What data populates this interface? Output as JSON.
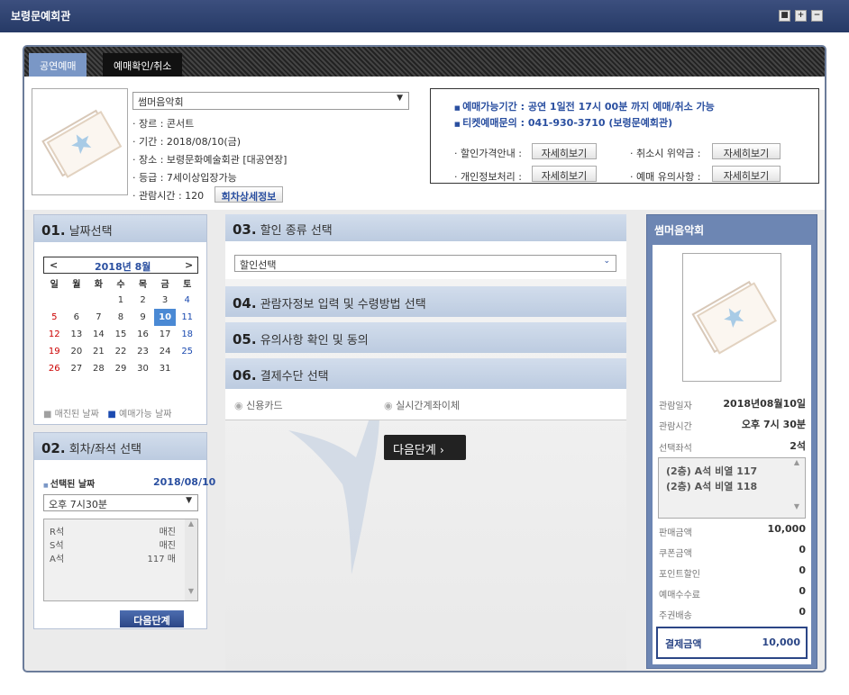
{
  "window": {
    "title": "보령문예회관",
    "btn_min": "■",
    "btn_plus": "+",
    "btn_close": "−"
  },
  "tabs": [
    {
      "label": "공연예매"
    },
    {
      "label": "예매확인/취소"
    }
  ],
  "show": {
    "title": "썸머음악회",
    "genre": "· 장르 : 콘서트",
    "period": "· 기간 : 2018/08/10(금)",
    "venue": "· 장소 : 보령문화예술회관 [대공연장]",
    "grade": "· 등급 : 7세이상입장가능",
    "runtime": "· 관람시간 : 120",
    "detail_btn": "회차상세정보"
  },
  "notice": {
    "line1": "예매가능기간 : 공연 1일전 17시 00분 까지 예매/취소 가능",
    "line2": "티켓예매문의 : 041-930-3710 (보령문예회관)",
    "items": [
      {
        "label": "· 할인가격안내 :",
        "btn": "자세히보기"
      },
      {
        "label": "· 취소시 위약금 :",
        "btn": "자세히보기"
      },
      {
        "label": "· 개인정보처리 :",
        "btn": "자세히보기"
      },
      {
        "label": "· 예매 유의사항 :",
        "btn": "자세히보기"
      }
    ]
  },
  "step01": {
    "num": "01.",
    "title": "날짜선택",
    "month": "2018년 8월",
    "prev": "<",
    "next": ">",
    "weekdays": [
      "일",
      "월",
      "화",
      "수",
      "목",
      "금",
      "토"
    ],
    "weeks": [
      [
        "",
        "",
        "",
        "1",
        "2",
        "3",
        "4"
      ],
      [
        "5",
        "6",
        "7",
        "8",
        "9",
        "10",
        "11"
      ],
      [
        "12",
        "13",
        "14",
        "15",
        "16",
        "17",
        "18"
      ],
      [
        "19",
        "20",
        "21",
        "22",
        "23",
        "24",
        "25"
      ],
      [
        "26",
        "27",
        "28",
        "29",
        "30",
        "31",
        ""
      ]
    ],
    "selected_day": "10",
    "legend_closed": "매진된 날짜",
    "legend_available": "예매가능 날짜",
    "color_closed": "#a0a0a0",
    "color_available": "#1b4ab0"
  },
  "step02": {
    "num": "02.",
    "title": "회차/좌석 선택",
    "selected_label": "선택된 날짜",
    "selected_date": "2018/08/10",
    "time": "오후 7시30분",
    "seats": [
      {
        "grade": "R석",
        "status": "매진"
      },
      {
        "grade": "S석",
        "status": "매진"
      },
      {
        "grade": "A석",
        "status": "117 매"
      }
    ],
    "next_btn": "다음단계"
  },
  "step03": {
    "num": "03.",
    "title": "할인 종류 선택",
    "select": "할인선택"
  },
  "step04": {
    "num": "04.",
    "title": "관람자정보 입력 및 수령방법 선택"
  },
  "step05": {
    "num": "05.",
    "title": "유의사항 확인 및 동의"
  },
  "step06": {
    "num": "06.",
    "title": "결제수단 선택",
    "opt1": "신용카드",
    "opt2": "실시간계좌이체"
  },
  "next_btn": "다음단계",
  "summary": {
    "title": "썸머음악회",
    "date_label": "관람일자",
    "date": "2018년08월10일",
    "time_label": "관람시간",
    "time": "오후 7시 30분",
    "seat_label": "선택좌석",
    "seat_count": "2석",
    "seats": [
      "(2층) A석 비열 117",
      "(2층) A석 비열 118"
    ],
    "sale_label": "판매금액",
    "sale": "10,000",
    "coupon_label": "쿠폰금액",
    "coupon": "0",
    "point_label": "포인트할인",
    "point": "0",
    "fee_label": "예매수수료",
    "fee": "0",
    "delivery_label": "주권배송",
    "delivery": "0",
    "total_label": "결제금액",
    "total": "10,000"
  }
}
